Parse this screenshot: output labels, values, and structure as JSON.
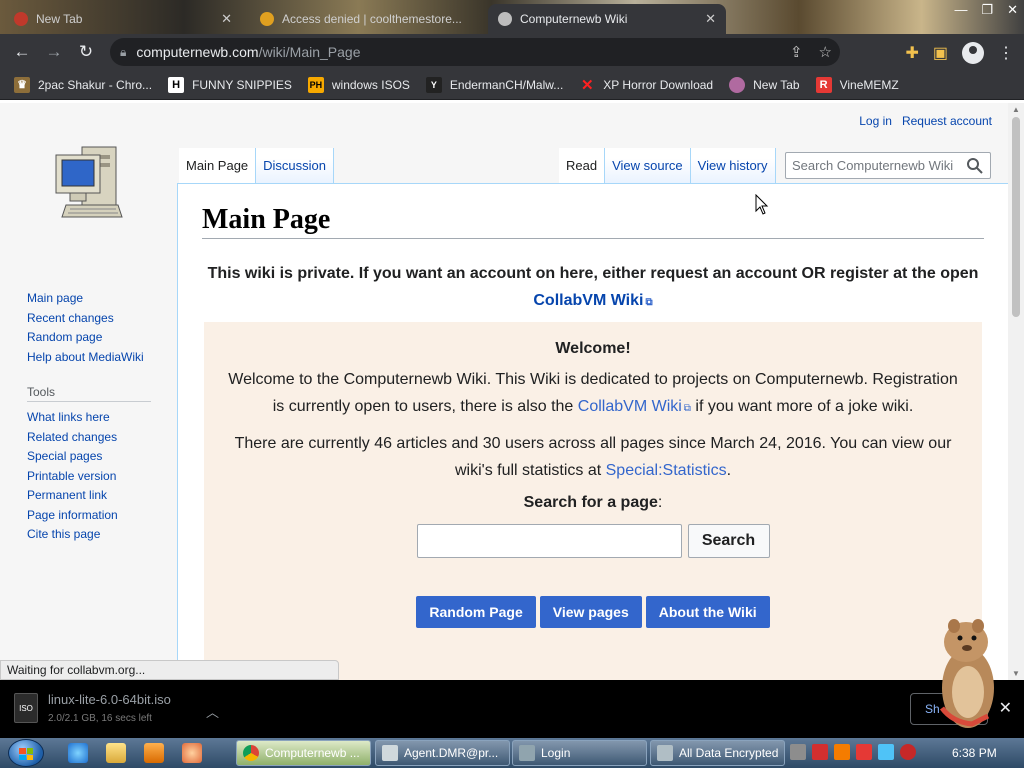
{
  "browser": {
    "tabs": [
      {
        "title": "New Tab",
        "favicon_color": "#c0392b"
      },
      {
        "title": "Access denied | coolthemestore...",
        "favicon_color": "#e0a020"
      },
      {
        "title": "Computernewb Wiki",
        "favicon_color": "#bdbdbd",
        "active": true
      }
    ],
    "url_host": "computernewb.com",
    "url_path": "/wiki/Main_Page",
    "bookmarks": [
      {
        "label": "2pac Shakur - Chro...",
        "icon": "Y",
        "color": "#e8a838"
      },
      {
        "label": "FUNNY SNIPPIES",
        "icon": "H",
        "color": "#ffffff"
      },
      {
        "label": "windows ISOS",
        "icon": "PH",
        "color": "#f7a900"
      },
      {
        "label": "EndermanCH/Malw...",
        "icon": "Y",
        "color": "#ffffff"
      },
      {
        "label": "XP Horror Download",
        "icon": "X",
        "color": "#ff2020"
      },
      {
        "label": "New Tab",
        "icon": "●",
        "color": "#b06aa0"
      },
      {
        "label": "VineMEMZ",
        "icon": "R",
        "color": "#e53935"
      }
    ]
  },
  "wiki": {
    "personal": {
      "login": "Log in",
      "request": "Request account"
    },
    "sidebar": {
      "nav": [
        "Main page",
        "Recent changes",
        "Random page",
        "Help about MediaWiki"
      ],
      "tools_title": "Tools",
      "tools": [
        "What links here",
        "Related changes",
        "Special pages",
        "Printable version",
        "Permanent link",
        "Page information",
        "Cite this page"
      ]
    },
    "tabs_left": [
      "Main Page",
      "Discussion"
    ],
    "tabs_right": [
      "Read",
      "View source",
      "View history"
    ],
    "search_placeholder": "Search Computernewb Wiki",
    "heading": "Main Page",
    "notice": {
      "text": "This wiki is private. If you want an account on here, either request an account OR register at the open",
      "link": "CollabVM Wiki"
    },
    "welcome": {
      "title": "Welcome!",
      "p1_before": "Welcome to the Computernewb Wiki. This Wiki is dedicated to projects on Computernewb. Registration is currently open to users, there is also the",
      "p1_link": "CollabVM Wiki",
      "p1_after": "if you want more of a joke wiki.",
      "p2_before": "There are currently 46 articles and 30 users across all pages since March 24, 2016. You can view our wiki's full statistics at",
      "p2_link": "Special:Statistics",
      "p2_after": ".",
      "search_title": "Search for a page",
      "search_button": "Search",
      "buttons": [
        "Random Page",
        "View pages",
        "About the Wiki"
      ]
    },
    "status": "Waiting for collabvm.org..."
  },
  "download": {
    "name": "linux-lite-6.0-64bit.iso",
    "meta": "2.0/2.1 GB, 16 secs left",
    "show_all": "Sh"
  },
  "taskbar": {
    "tasks": [
      {
        "label": "Computernewb ...",
        "color": "#4285f4",
        "active": true
      },
      {
        "label": "Agent.DMR@pr...",
        "color": "#cfd8dc"
      },
      {
        "label": "Login",
        "color": "#90a4ae"
      },
      {
        "label": "All Data Encrypted",
        "color": "#b0bec5"
      }
    ],
    "clock": "6:38 PM"
  }
}
